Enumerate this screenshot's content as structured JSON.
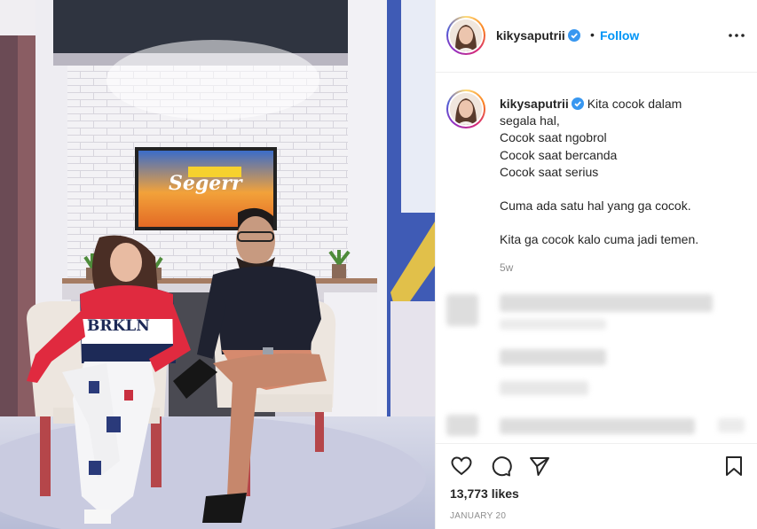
{
  "post": {
    "username": "kikysaputrii",
    "verified": true,
    "dot": "•",
    "follow_label": "Follow",
    "more_icon": "more-horizontal-icon",
    "caption_first": "Kita cocok dalam",
    "caption_lines": [
      "segala hal,",
      "Cocok saat ngobrol",
      "Cocok saat bercanda",
      "Cocok saat serius",
      "",
      "Cuma ada satu hal yang ga cocok.",
      "",
      "Kita ga cocok kalo cuma jadi temen."
    ],
    "time_ago": "5w",
    "likes": "13,773 likes",
    "date": "JANUARY 20"
  },
  "photo": {
    "tv_text": "Segerr",
    "shirt_text": "BRKLN"
  },
  "colors": {
    "accent": "#0095f6",
    "text": "#262626",
    "muted": "#8e8e8e",
    "border": "#efefef"
  }
}
